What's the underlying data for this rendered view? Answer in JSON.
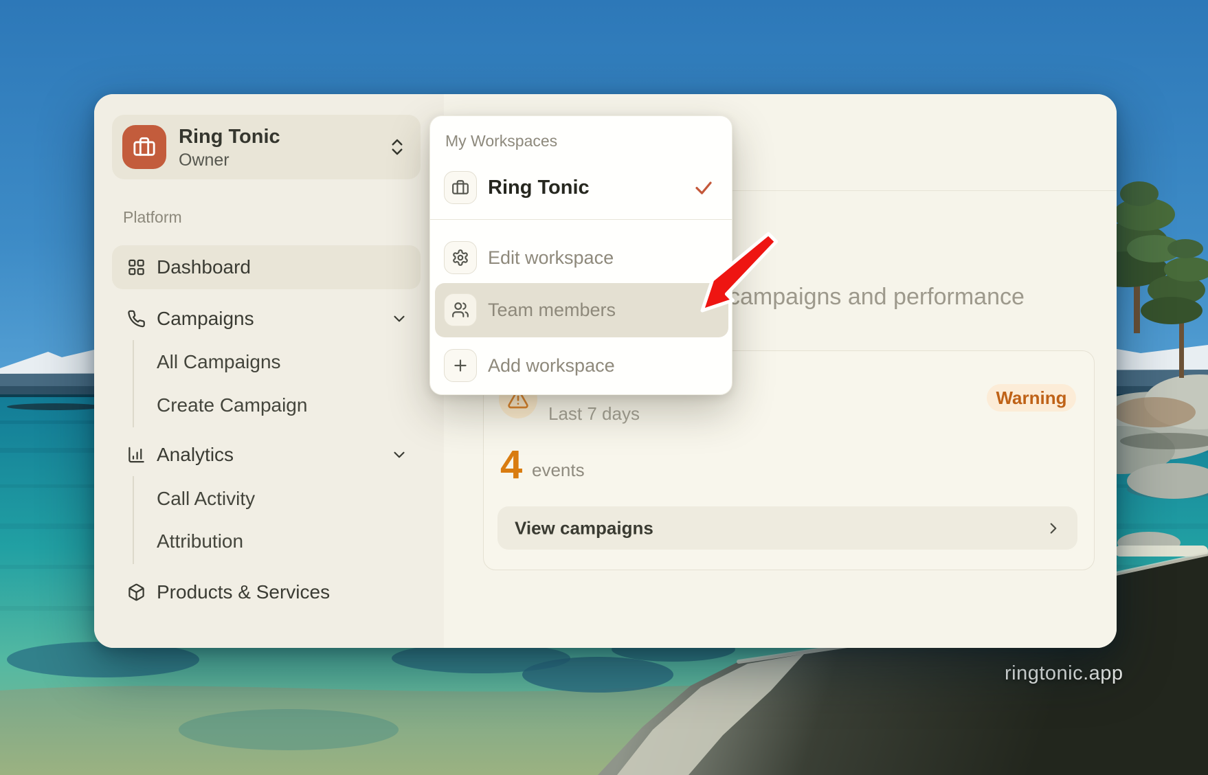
{
  "wallpaper": {
    "watermark": "ringtonic.app"
  },
  "sidebar": {
    "workspace": {
      "name": "Ring Tonic",
      "role": "Owner"
    },
    "section": "Platform",
    "items": [
      {
        "label": "Dashboard",
        "icon": "grid-icon",
        "active": true
      },
      {
        "label": "Campaigns",
        "icon": "phone-icon",
        "expandable": true
      },
      {
        "label": "All Campaigns"
      },
      {
        "label": "Create Campaign"
      },
      {
        "label": "Analytics",
        "icon": "bar-chart-icon",
        "expandable": true
      },
      {
        "label": "Call Activity"
      },
      {
        "label": "Attribution"
      },
      {
        "label": "Products & Services",
        "icon": "package-icon"
      }
    ]
  },
  "menu": {
    "header": "My Workspaces",
    "workspace": {
      "name": "Ring Tonic",
      "selected": true
    },
    "items": [
      {
        "label": "Edit workspace",
        "icon": "gear-icon"
      },
      {
        "label": "Team members",
        "icon": "users-icon",
        "highlighted": true
      },
      {
        "label": "Add workspace",
        "icon": "plus-icon"
      }
    ]
  },
  "main": {
    "heading_visible": "campaigns and performance",
    "card": {
      "period": "Last 7 days",
      "badge": "Warning",
      "value": "4",
      "unit": "events",
      "cta": "View campaigns"
    }
  },
  "colors": {
    "accent_terracotta": "#c35c3c",
    "warning_text": "#bf6217",
    "warning_bg": "#fcecd7",
    "metric_orange": "#d97c10",
    "check_red": "#c4583a",
    "arrow_red": "#ee1512",
    "window_bg": "#f2efe5",
    "highlight_bg": "#e9e5d7"
  }
}
